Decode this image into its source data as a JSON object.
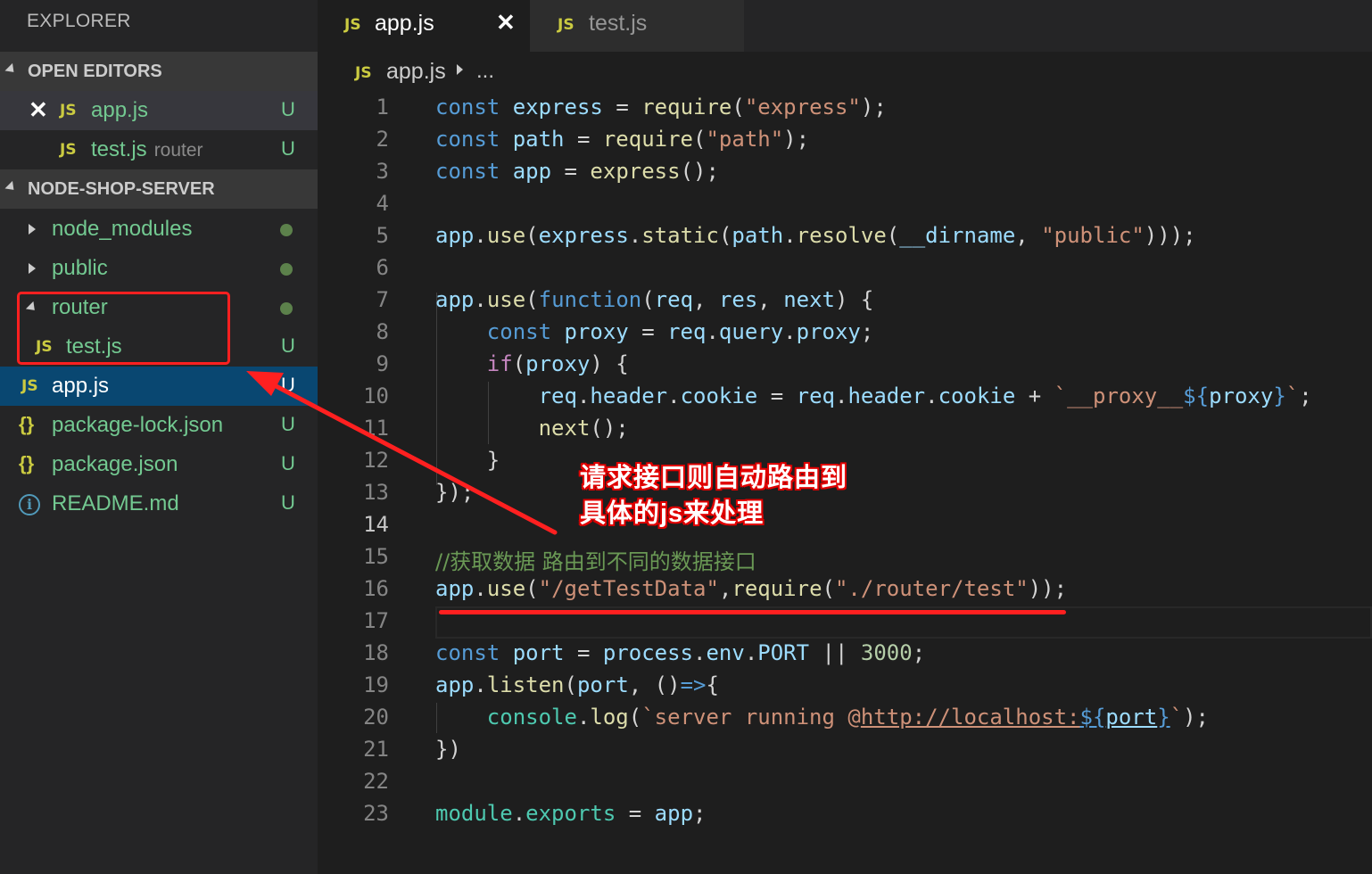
{
  "sidebar": {
    "title": "EXPLORER",
    "open_editors": {
      "label": "OPEN EDITORS",
      "items": [
        {
          "name": "app.js",
          "status": "U"
        },
        {
          "name": "test.js",
          "note": "router",
          "status": "U"
        }
      ]
    },
    "project": {
      "label": "NODE-SHOP-SERVER",
      "items": [
        {
          "name": "node_modules"
        },
        {
          "name": "public"
        },
        {
          "name": "router"
        },
        {
          "name": "test.js",
          "status": "U"
        },
        {
          "name": "app.js",
          "status": "U"
        },
        {
          "name": "package-lock.json",
          "status": "U"
        },
        {
          "name": "package.json",
          "status": "U"
        },
        {
          "name": "README.md",
          "status": "U"
        }
      ]
    }
  },
  "tabs": [
    {
      "label": "app.js",
      "badge": "JS",
      "active": true
    },
    {
      "label": "test.js",
      "badge": "JS",
      "active": false
    }
  ],
  "breadcrumb": {
    "badge": "JS",
    "file": "app.js",
    "more": "..."
  },
  "editor": {
    "current_line": 14,
    "line_numbers": [
      "1",
      "2",
      "3",
      "4",
      "5",
      "6",
      "7",
      "8",
      "9",
      "10",
      "11",
      "12",
      "13",
      "14",
      "15",
      "16",
      "17",
      "18",
      "19",
      "20",
      "21",
      "22",
      "23"
    ],
    "lines": {
      "l1": [
        "const",
        "express",
        "=",
        "require",
        "(",
        "\"express\"",
        ");"
      ],
      "l2": [
        "const",
        "path",
        "=",
        "require",
        "(",
        "\"path\"",
        ");"
      ],
      "l3": [
        "const",
        "app",
        "=",
        "express",
        "();"
      ],
      "l5": [
        "app",
        ".",
        "use",
        "(",
        "express",
        ".",
        "static",
        "(",
        "path",
        ".",
        "resolve",
        "(",
        "__dirname",
        ", ",
        "\"public\"",
        ")));"
      ],
      "l7": [
        "app",
        ".",
        "use",
        "(",
        "function",
        "(",
        "req",
        ", ",
        "res",
        ", ",
        "next",
        ") {"
      ],
      "l8": [
        "const",
        "proxy",
        "=",
        "req",
        ".",
        "query",
        ".",
        "proxy",
        ";"
      ],
      "l9": [
        "if",
        "(",
        "proxy",
        ") {"
      ],
      "l10": [
        "req",
        ".",
        "header",
        ".",
        "cookie",
        " = ",
        "req",
        ".",
        "header",
        ".",
        "cookie",
        " + ",
        "`__proxy__",
        "${",
        "proxy",
        "}",
        "`",
        ";"
      ],
      "l11": [
        "next",
        "();"
      ],
      "l12": [
        "}"
      ],
      "l13": [
        "});"
      ],
      "l15": [
        "//获取数据 路由到不同的数据接口"
      ],
      "l16": [
        "app",
        ".",
        "use",
        "(",
        "\"/getTestData\"",
        ",",
        "require",
        "(",
        "\"./router/test\"",
        "));"
      ],
      "l18": [
        "const",
        "port",
        "=",
        "process",
        ".",
        "env",
        ".",
        "PORT",
        "||",
        "3000",
        ";"
      ],
      "l19": [
        "app",
        ".",
        "listen",
        "(",
        "port",
        ", ",
        "()",
        "=>",
        "{"
      ],
      "l20": [
        "console",
        ".",
        "log",
        "(",
        "`server running @",
        "http://localhost:",
        "${",
        "port",
        "}",
        "`",
        ");"
      ],
      "l21": [
        "})"
      ],
      "l23": [
        "module",
        ".",
        "exports",
        "=",
        "app",
        ";"
      ]
    }
  },
  "annotation": {
    "line1": "请求接口则自动路由到",
    "line2": "具体的js来处理",
    "color": "#ff2020"
  }
}
